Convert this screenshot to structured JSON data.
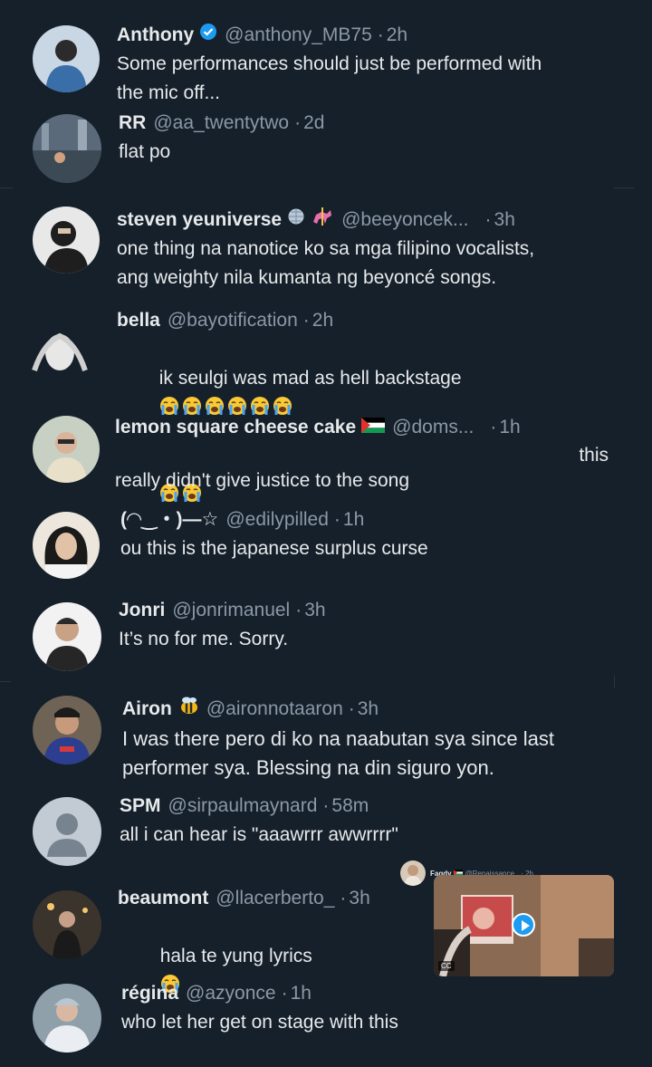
{
  "colors": {
    "background": "#15202b",
    "name": "#e7e9ea",
    "muted": "#8b98a5",
    "verified": "#1d9bf0"
  },
  "replies": [
    {
      "name": "Anthony",
      "verified": true,
      "handle": "@anthony_MB75",
      "time": "2h",
      "text": "Some performances should just be performed with\nthe mic off..."
    },
    {
      "name": "RR",
      "handle": "@aa_twentytwo",
      "time": "2d",
      "text": "flat po"
    },
    {
      "name": "steven yeuniverse",
      "badges": [
        "disco-ball-emoji",
        "carousel-horse-emoji"
      ],
      "handle": "@beeyoncek...",
      "time": "3h",
      "text": "one thing na nanotice ko sa mga filipino vocalists,\nang weighty nila kumanta ng beyoncé songs."
    },
    {
      "name": "bella",
      "handle": "@bayotification",
      "time": "2h",
      "text": "ik seulgi was mad as hell backstage",
      "emoji_count_line1": 6,
      "emoji_count_line2": 2
    },
    {
      "name": "lemon square cheese cake",
      "badges": [
        "palestine-flag-emoji"
      ],
      "handle": "@doms...",
      "time": "1h",
      "text_right": "this",
      "text": "really didn't give justice to the song"
    },
    {
      "name": "(◠‿・)—☆",
      "handle": "@edilypilled",
      "time": "1h",
      "text": "ou this is the japanese surplus curse"
    },
    {
      "name": "Jonri",
      "handle": "@jonrimanuel",
      "time": "3h",
      "text": "It’s no for me. Sorry."
    },
    {
      "name": "Airon",
      "badges": [
        "bee-emoji"
      ],
      "handle": "@aironnotaaron",
      "time": "3h",
      "text": "I was there pero di ko na naabutan sya since last\nperformer sya. Blessing na din siguro yon."
    },
    {
      "name": "SPM",
      "handle": "@sirpaulmaynard",
      "time": "58m",
      "text": "all i can hear is \"aaawrrr awwrrrr\""
    },
    {
      "name": "beaumont",
      "handle": "@llacerberto_",
      "time": "3h",
      "text": "hala te yung lyrics",
      "emoji_count_line1": 1
    },
    {
      "name": "régina",
      "handle": "@azyonce",
      "time": "1h",
      "text": "who let her get on stage with this"
    }
  ],
  "embed": {
    "name": "Fagdy",
    "badge": "palestine-flag-emoji",
    "handle": "@Renaissance_",
    "time": "2h",
    "play_icon": "play-icon",
    "caption_badge": "CC"
  },
  "separator": "·"
}
